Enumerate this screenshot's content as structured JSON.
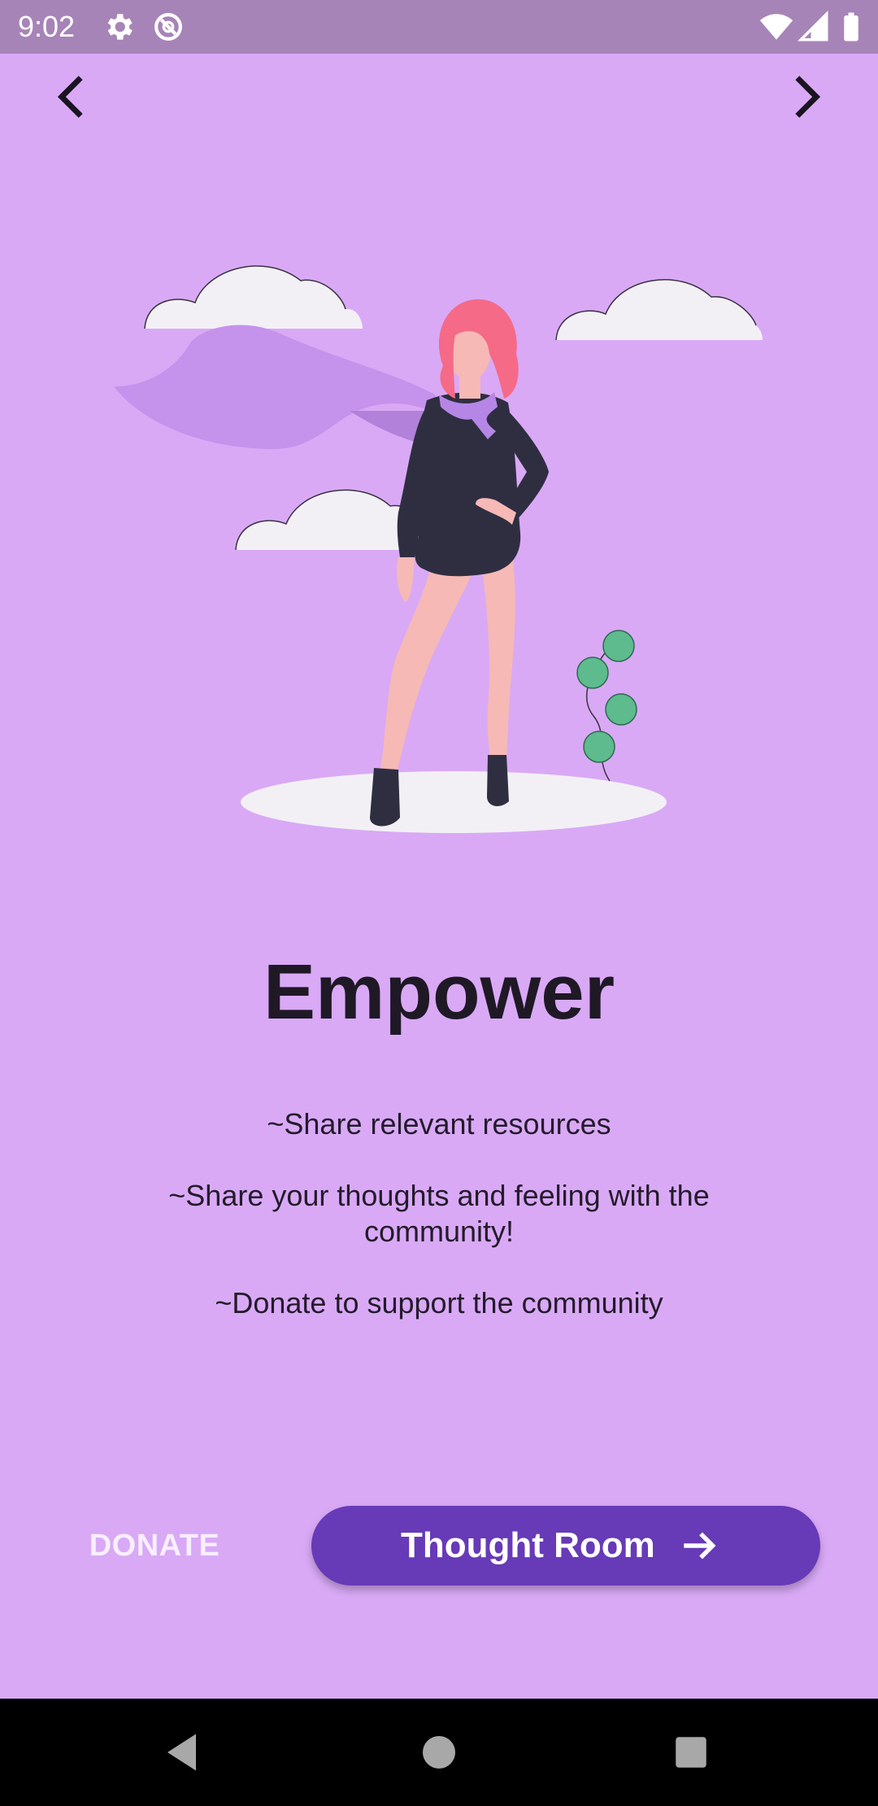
{
  "status_bar": {
    "time": "9:02",
    "icons": [
      "settings-icon",
      "data-saver-icon",
      "wifi-icon",
      "signal-icon",
      "battery-icon"
    ]
  },
  "nav": {
    "back_icon": "chevron-left-icon",
    "next_icon": "chevron-right-icon"
  },
  "illustration": {
    "subject": "woman-with-cape-illustration"
  },
  "page": {
    "title": "Empower",
    "bullets": [
      "~Share relevant resources",
      "~Share your thoughts and feeling with the community!",
      "~Donate to support the community"
    ]
  },
  "actions": {
    "donate_label": "DONATE",
    "primary_label": "Thought Room",
    "primary_icon": "arrow-right-icon"
  },
  "colors": {
    "background": "#d9a9f6",
    "status_bar": "#a784b7",
    "primary": "#673ab7"
  },
  "system_nav": {
    "icons": [
      "back-triangle-icon",
      "home-circle-icon",
      "recents-square-icon"
    ]
  }
}
